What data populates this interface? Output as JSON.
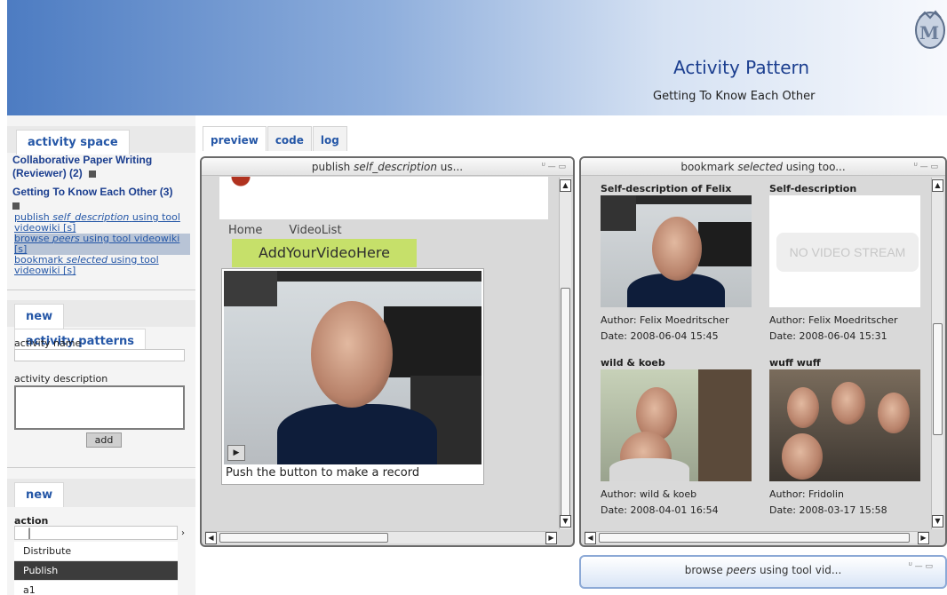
{
  "header": {
    "title": "Activity Pattern",
    "subtitle": "Getting To Know Each Other"
  },
  "sidebar": {
    "space_tab": "activity space",
    "spaces": [
      {
        "label": "Collaborative Paper Writing (Reviewer) (2)"
      },
      {
        "label": "Getting To Know Each Other (3)"
      }
    ],
    "activities": [
      {
        "verb": "publish",
        "obj": "self_description",
        "rest": "using tool videowiki",
        "tag": "[s]"
      },
      {
        "verb": "browse",
        "obj": "peers",
        "rest": "using tool videowiki",
        "tag": "[s]"
      },
      {
        "verb": "bookmark",
        "obj": "selected",
        "rest": "using tool videowiki",
        "tag": "[s]"
      }
    ],
    "patterns_tabs": [
      "new",
      "activity patterns"
    ],
    "activity_name_label": "activity name",
    "activity_name_value": "",
    "activity_description_label": "activity description",
    "add_button": "add",
    "new_tab": "new",
    "action_label": "action",
    "action_value": "|",
    "action_options": [
      "Distribute",
      "Publish",
      "a1"
    ],
    "action_selected": "Publish"
  },
  "main_tabs": [
    "preview",
    "code",
    "log"
  ],
  "main_tab_active": "preview",
  "widgets": {
    "publish": {
      "title_pre": "publish ",
      "title_em": "self_description",
      "title_post": " us...",
      "nav": [
        "Home",
        "VideoList"
      ],
      "add_button": "AddYourVideoHere",
      "caption": "Push the button to make a record"
    },
    "bookmark": {
      "title_pre": "bookmark ",
      "title_em": "selected",
      "title_post": " using too...",
      "items": [
        {
          "title": "Self-description of Felix",
          "author": "Author: Felix Moedritscher",
          "date": "Date: 2008-06-04 15:45"
        },
        {
          "title": "Self-description",
          "author": "Author: Felix Moedritscher",
          "date": "Date: 2008-06-04 15:31",
          "no_video": "NO VIDEO STREAM"
        },
        {
          "title": "wild & koeb",
          "author": "Author: wild & koeb",
          "date": "Date: 2008-04-01 16:54"
        },
        {
          "title": "wuff wuff",
          "author": "Author: Fridolin",
          "date": "Date: 2008-03-17 15:58"
        }
      ]
    },
    "browse": {
      "title_pre": "browse ",
      "title_em": "peers",
      "title_post": " using tool vid..."
    }
  },
  "colors": {
    "accent": "#2557a7",
    "header_blue": "#4d7cc2",
    "add_button_green": "#c6e06a"
  }
}
